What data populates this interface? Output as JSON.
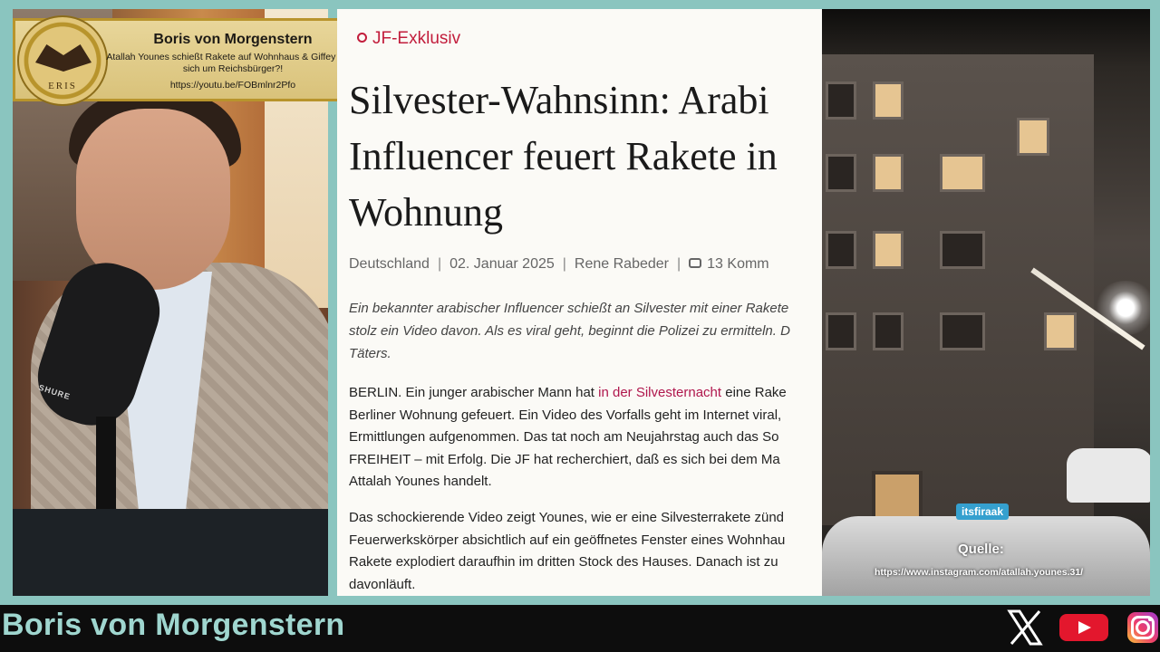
{
  "banner": {
    "title": "Boris von Morgenstern",
    "subtitle": "Atallah Younes schießt Rakete auf Wohnhaus & Giffey sorgt sich um Reichsbürger?!",
    "url": "https://youtu.be/FOBmlnr2Pfo",
    "logo_text": "ERIS"
  },
  "webcam": {
    "mic_label": "SHURE"
  },
  "article": {
    "tag": "JF-Exklusiv",
    "headline_lines": [
      "Silvester-Wahnsinn: Arabi",
      "Influencer feuert Rakete in",
      "Wohnung"
    ],
    "meta": {
      "category": "Deutschland",
      "date": "02. Januar 2025",
      "author": "Rene Rabeder",
      "comments": "13 Komm"
    },
    "lead_lines": [
      "Ein bekannter arabischer Influencer schießt an Silvester mit einer Rakete",
      "stolz ein Video davon. Als es viral geht, beginnt die Polizei zu ermitteln. D",
      "Täters."
    ],
    "body1": {
      "line1_pre": "BERLIN. Ein junger arabischer Mann hat ",
      "line1_link": "in der Silvesternacht",
      "line1_post": " eine Rake",
      "lines": [
        "Berliner Wohnung gefeuert. Ein Video des Vorfalls geht im Internet viral,",
        "Ermittlungen aufgenommen. Das tat noch am Neujahrstag auch das So",
        "FREIHEIT – mit Erfolg. Die JF hat recherchiert, daß es sich bei dem Ma",
        "Attalah Younes handelt."
      ]
    },
    "body2_lines": [
      "Das schockierende Video zeigt Younes, wie er eine Silvesterrakete zünd",
      "Feuerwerkskörper absichtlich auf ein geöffnetes Fenster eines Wohnhau",
      "Rakete explodiert daraufhin im dritten Stock des Hauses. Danach ist zu",
      "davonläuft."
    ]
  },
  "video": {
    "tag": "itsfiraak",
    "source_label": "Quelle:",
    "source_url": "https://www.instagram.com/atallah.younes.31/"
  },
  "bottom_bar": {
    "name": "Boris von Morgenstern",
    "icons": [
      "x-icon",
      "youtube-icon",
      "instagram-icon"
    ]
  },
  "colors": {
    "frame": "#8ac5bf",
    "accent_red": "#c21d3c",
    "link": "#b0174d",
    "name_text": "#9fd6cf"
  }
}
